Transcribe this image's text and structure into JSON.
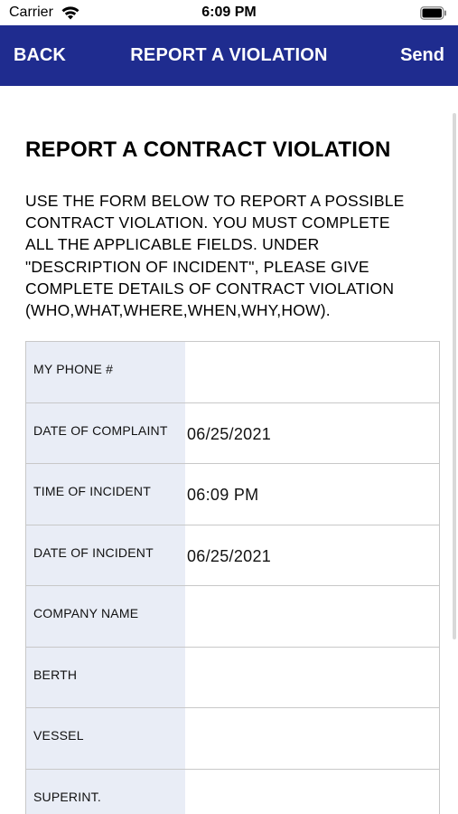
{
  "status_bar": {
    "carrier": "Carrier",
    "time": "6:09 PM"
  },
  "nav": {
    "back_label": "BACK",
    "title": "REPORT A VIOLATION",
    "send_label": "Send",
    "background_color": "#1f2c8f"
  },
  "page": {
    "title": "REPORT A CONTRACT VIOLATION",
    "instructions": [
      "USE THE FORM BELOW TO REPORT A POSSIBLE",
      "CONTRACT VIOLATION. YOU MUST COMPLETE",
      "ALL THE APPLICABLE FIELDS. UNDER",
      "\"DESCRIPTION OF INCIDENT\", PLEASE GIVE",
      "COMPLETE DETAILS OF CONTRACT VIOLATION",
      "(WHO,WHAT,WHERE,WHEN,WHY,HOW)."
    ]
  },
  "form": {
    "fields": [
      {
        "label": "MY PHONE #",
        "value": ""
      },
      {
        "label": "DATE OF COMPLAINT",
        "value": "06/25/2021"
      },
      {
        "label": "TIME OF INCIDENT",
        "value": "06:09 PM"
      },
      {
        "label": "DATE OF INCIDENT",
        "value": "06/25/2021"
      },
      {
        "label": "COMPANY NAME",
        "value": ""
      },
      {
        "label": "BERTH",
        "value": ""
      },
      {
        "label": "VESSEL",
        "value": ""
      },
      {
        "label": "SUPERINT.",
        "value": ""
      }
    ],
    "label_background_color": "#e9edf6"
  },
  "icons": {
    "wifi": "wifi-icon",
    "battery": "battery-icon"
  }
}
